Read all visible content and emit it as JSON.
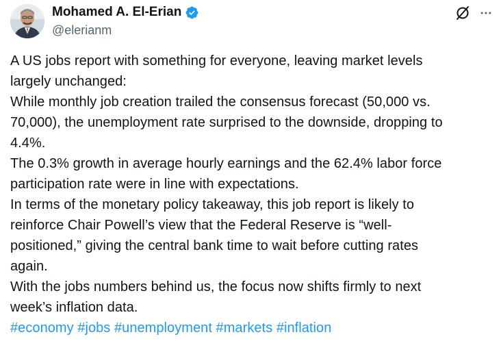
{
  "author": {
    "display_name": "Mohamed A. El-Erian",
    "handle": "@elerianm",
    "verified": true,
    "avatar_icon": "person-avatar"
  },
  "actions": {
    "grok_icon": "grok-icon",
    "more_icon": "more-dots-icon"
  },
  "tweet": {
    "lines": [
      "A US jobs report with something for everyone, leaving market levels",
      "largely unchanged:",
      "While monthly job creation trailed the consensus forecast (50,000 vs.",
      "70,000), the unemployment rate surprised to the downside, dropping to",
      "4.4%.",
      "The 0.3% growth in average hourly earnings and the 62.4% labor force",
      "participation rate were in line with expectations.",
      "In terms of the monetary policy takeaway, this job report is likely to",
      "reinforce Chair Powell’s view that the Federal Reserve is “well-",
      "positioned,” giving the central bank time to wait before cutting rates",
      "again.",
      "With the jobs numbers behind us, the focus now shifts firmly to next",
      "week’s inflation data."
    ],
    "hashtags": [
      "#economy",
      "#jobs",
      "#unemployment",
      "#markets",
      "#inflation"
    ]
  },
  "colors": {
    "text": "#0f1419",
    "secondary": "#536471",
    "link": "#1d9bf0",
    "verified": "#1d9bf0"
  }
}
